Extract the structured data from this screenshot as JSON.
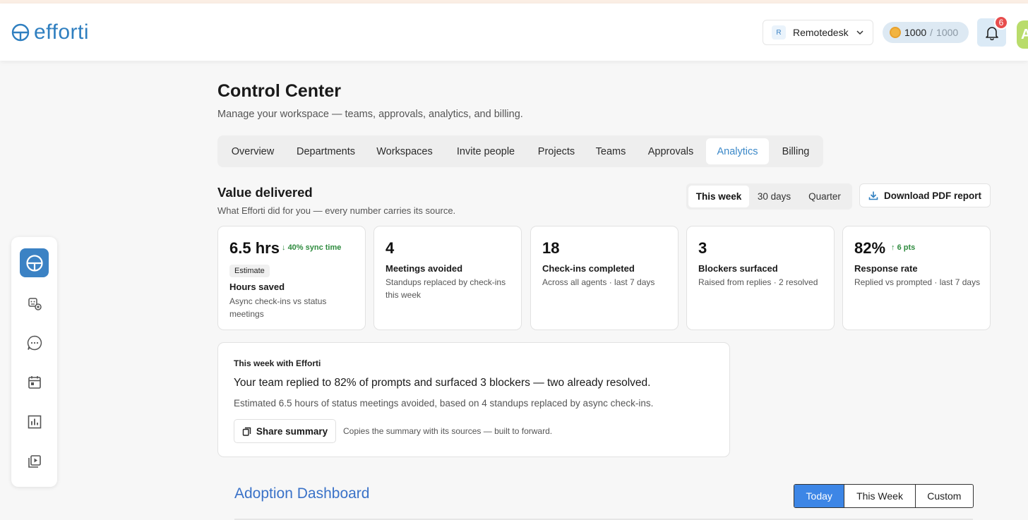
{
  "header": {
    "logo_text": "efforti",
    "workspace": {
      "badge": "R",
      "name": "Remotedesk"
    },
    "credits": {
      "used": "1000",
      "separator": " / ",
      "total": "1000"
    },
    "notifications_count": "6",
    "avatar_initial": "A"
  },
  "sidebar": {
    "items": [
      {
        "name": "logo-icon",
        "active": true
      },
      {
        "name": "agents-icon",
        "active": false
      },
      {
        "name": "chat-icon",
        "active": false
      },
      {
        "name": "calendar-icon",
        "active": false
      },
      {
        "name": "analytics-icon",
        "active": false
      },
      {
        "name": "video-library-icon",
        "active": false
      }
    ]
  },
  "page": {
    "title": "Control Center",
    "subtitle": "Manage your workspace — teams, approvals, analytics, and billing."
  },
  "tabs": [
    {
      "label": "Overview",
      "active": false
    },
    {
      "label": "Departments",
      "active": false
    },
    {
      "label": "Workspaces",
      "active": false
    },
    {
      "label": "Invite people",
      "active": false
    },
    {
      "label": "Projects",
      "active": false
    },
    {
      "label": "Teams",
      "active": false
    },
    {
      "label": "Approvals",
      "active": false
    },
    {
      "label": "Analytics",
      "active": true
    },
    {
      "label": "Billing",
      "active": false
    }
  ],
  "value_section": {
    "title": "Value delivered",
    "subtitle": "What Efforti did for you — every number carries its source.",
    "ranges": [
      {
        "label": "This week",
        "active": true
      },
      {
        "label": "30 days",
        "active": false
      },
      {
        "label": "Quarter",
        "active": false
      }
    ],
    "download_label": "Download PDF report"
  },
  "cards": [
    {
      "value": "6.5 hrs",
      "delta": "40% sync time",
      "delta_direction": "down",
      "tag": "Estimate",
      "label": "Hours saved",
      "description": "Async check-ins vs status meetings"
    },
    {
      "value": "4",
      "delta": "",
      "delta_direction": "",
      "tag": "",
      "label": "Meetings avoided",
      "description": "Standups replaced by check-ins this week"
    },
    {
      "value": "18",
      "delta": "",
      "delta_direction": "",
      "tag": "",
      "label": "Check-ins completed",
      "description": "Across all agents · last 7 days"
    },
    {
      "value": "3",
      "delta": "",
      "delta_direction": "",
      "tag": "",
      "label": "Blockers surfaced",
      "description": "Raised from replies · 2 resolved"
    },
    {
      "value": "82%",
      "delta": "6 pts",
      "delta_direction": "up",
      "tag": "",
      "label": "Response rate",
      "description": "Replied vs prompted · last 7 days"
    }
  ],
  "summary": {
    "heading": "This week with Efforti",
    "text": "Your team replied to 82% of prompts and surfaced 3 blockers — two already resolved.",
    "detail": "Estimated 6.5 hours of status meetings avoided, based on 4 standups replaced by async check-ins.",
    "share_label": "Share summary",
    "share_note": "Copies the summary with its sources — built to forward."
  },
  "adoption": {
    "title": "Adoption Dashboard",
    "ranges": [
      {
        "label": "Today",
        "active": true
      },
      {
        "label": "This Week",
        "active": false
      },
      {
        "label": "Custom",
        "active": false
      }
    ]
  },
  "colors": {
    "brand": "#2f7fc0",
    "active_tab": "#3b88c8",
    "positive": "#2e8b3e",
    "notification": "#e74c4c",
    "adoption_active": "#3d86e6"
  }
}
